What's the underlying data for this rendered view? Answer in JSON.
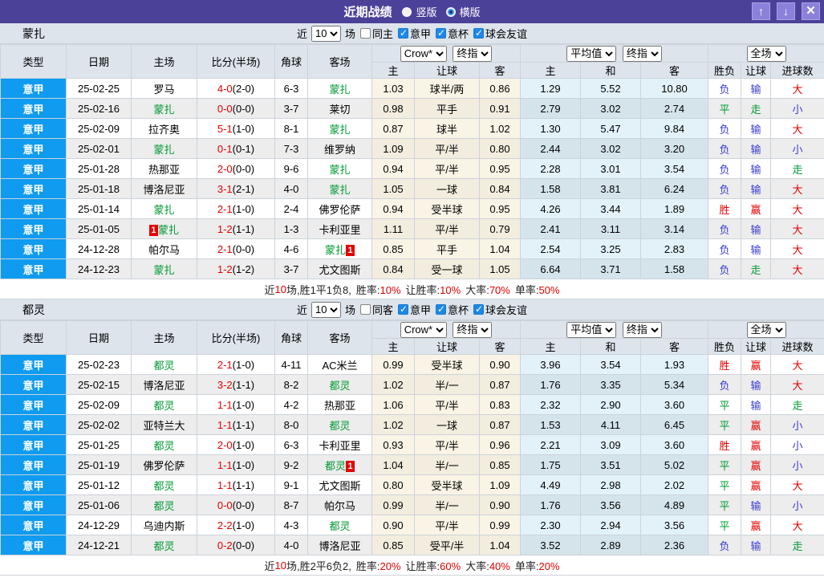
{
  "title_bar": {
    "title": "近期战绩",
    "vertical_label": "竖版",
    "vertical_checked": true,
    "horizontal_label": "横版",
    "horizontal_checked": false
  },
  "icons": {
    "move-up": "↑",
    "move-down": "↓",
    "close": "✕"
  },
  "labels": {
    "recent": "近",
    "games": "场",
    "serie_a": "意甲",
    "cup": "意杯",
    "friendly": "球会友谊"
  },
  "columns": {
    "type": "类型",
    "date": "日期",
    "home": "主场",
    "score": "比分(半场)",
    "corner": "角球",
    "away": "客场",
    "crow_home": "主",
    "crow_handicap": "让球",
    "crow_away": "客",
    "avg_home": "主",
    "avg_draw": "和",
    "avg_away": "客",
    "result": "胜负",
    "handicap_result": "让球",
    "goals": "进球数"
  },
  "colors": {
    "accent_purple": "#4c4198",
    "type_blue": "#0f9bef",
    "win_red": "#e30000",
    "draw_green": "#009933",
    "loss_blue": "#3a3ad0"
  },
  "sections": [
    {
      "team": "蒙扎",
      "controls": {
        "same_label": "同主",
        "same_checked": false,
        "serie_a_checked": true,
        "cup_checked": true,
        "friendly_checked": true
      },
      "selects": {
        "count": "10",
        "book": "Crow*",
        "book_period": "终指",
        "avg": "平均值",
        "avg_period": "终指",
        "scope": "全场"
      },
      "rows": [
        {
          "league": "意甲",
          "date": "25-02-25",
          "home": {
            "name": "罗马",
            "self": false
          },
          "score": "4-0",
          "half": "(2-0)",
          "corner": "6-3",
          "away": {
            "name": "蒙扎",
            "self": true
          },
          "crow": [
            "1.03",
            "球半/两",
            "0.86"
          ],
          "avg": [
            "1.29",
            "5.52",
            "10.80"
          ],
          "outcome": [
            "负",
            "输",
            "大"
          ]
        },
        {
          "league": "意甲",
          "date": "25-02-16",
          "home": {
            "name": "蒙扎",
            "self": true
          },
          "score": "0-0",
          "half": "(0-0)",
          "corner": "3-7",
          "away": {
            "name": "莱切",
            "self": false
          },
          "crow": [
            "0.98",
            "平手",
            "0.91"
          ],
          "avg": [
            "2.79",
            "3.02",
            "2.74"
          ],
          "outcome": [
            "平",
            "走",
            "小"
          ]
        },
        {
          "league": "意甲",
          "date": "25-02-09",
          "home": {
            "name": "拉齐奥",
            "self": false
          },
          "score": "5-1",
          "half": "(1-0)",
          "corner": "8-1",
          "away": {
            "name": "蒙扎",
            "self": true
          },
          "crow": [
            "0.87",
            "球半",
            "1.02"
          ],
          "avg": [
            "1.30",
            "5.47",
            "9.84"
          ],
          "outcome": [
            "负",
            "输",
            "大"
          ]
        },
        {
          "league": "意甲",
          "date": "25-02-01",
          "home": {
            "name": "蒙扎",
            "self": true
          },
          "score": "0-1",
          "half": "(0-1)",
          "corner": "7-3",
          "away": {
            "name": "维罗纳",
            "self": false
          },
          "crow": [
            "1.09",
            "平/半",
            "0.80"
          ],
          "avg": [
            "2.44",
            "3.02",
            "3.20"
          ],
          "outcome": [
            "负",
            "输",
            "小"
          ]
        },
        {
          "league": "意甲",
          "date": "25-01-28",
          "home": {
            "name": "热那亚",
            "self": false
          },
          "score": "2-0",
          "half": "(0-0)",
          "corner": "9-6",
          "away": {
            "name": "蒙扎",
            "self": true
          },
          "crow": [
            "0.94",
            "平/半",
            "0.95"
          ],
          "avg": [
            "2.28",
            "3.01",
            "3.54"
          ],
          "outcome": [
            "负",
            "输",
            "走"
          ]
        },
        {
          "league": "意甲",
          "date": "25-01-18",
          "home": {
            "name": "博洛尼亚",
            "self": false
          },
          "score": "3-1",
          "half": "(2-1)",
          "corner": "4-0",
          "away": {
            "name": "蒙扎",
            "self": true
          },
          "crow": [
            "1.05",
            "一球",
            "0.84"
          ],
          "avg": [
            "1.58",
            "3.81",
            "6.24"
          ],
          "outcome": [
            "负",
            "输",
            "大"
          ]
        },
        {
          "league": "意甲",
          "date": "25-01-14",
          "home": {
            "name": "蒙扎",
            "self": true
          },
          "score": "2-1",
          "half": "(1-0)",
          "corner": "2-4",
          "away": {
            "name": "佛罗伦萨",
            "self": false
          },
          "crow": [
            "0.94",
            "受半球",
            "0.95"
          ],
          "avg": [
            "4.26",
            "3.44",
            "1.89"
          ],
          "outcome": [
            "胜",
            "赢",
            "大"
          ]
        },
        {
          "league": "意甲",
          "date": "25-01-05",
          "home": {
            "name": "蒙扎",
            "self": true,
            "card": "1",
            "card_pos": "before"
          },
          "score": "1-2",
          "half": "(1-1)",
          "corner": "1-3",
          "away": {
            "name": "卡利亚里",
            "self": false
          },
          "crow": [
            "1.11",
            "平/半",
            "0.79"
          ],
          "avg": [
            "2.41",
            "3.11",
            "3.14"
          ],
          "outcome": [
            "负",
            "输",
            "大"
          ]
        },
        {
          "league": "意甲",
          "date": "24-12-28",
          "home": {
            "name": "帕尔马",
            "self": false
          },
          "score": "2-1",
          "half": "(0-0)",
          "corner": "4-6",
          "away": {
            "name": "蒙扎",
            "self": true,
            "card": "1",
            "card_pos": "after"
          },
          "crow": [
            "0.85",
            "平手",
            "1.04"
          ],
          "avg": [
            "2.54",
            "3.25",
            "2.83"
          ],
          "outcome": [
            "负",
            "输",
            "大"
          ]
        },
        {
          "league": "意甲",
          "date": "24-12-23",
          "home": {
            "name": "蒙扎",
            "self": true
          },
          "score": "1-2",
          "half": "(1-2)",
          "corner": "3-7",
          "away": {
            "name": "尤文图斯",
            "self": false
          },
          "crow": [
            "0.84",
            "受一球",
            "1.05"
          ],
          "avg": [
            "6.64",
            "3.71",
            "1.58"
          ],
          "outcome": [
            "负",
            "走",
            "大"
          ]
        }
      ],
      "summary": {
        "lead": "近",
        "count": "10",
        "record": "场,胜1平1负8,",
        "stats": [
          {
            "label": "胜率:",
            "value": "10%"
          },
          {
            "label": "让胜率:",
            "value": "10%"
          },
          {
            "label": "大率:",
            "value": "70%"
          },
          {
            "label": "单率:",
            "value": "50%"
          }
        ]
      }
    },
    {
      "team": "都灵",
      "controls": {
        "same_label": "同客",
        "same_checked": false,
        "serie_a_checked": true,
        "cup_checked": true,
        "friendly_checked": true
      },
      "selects": {
        "count": "10",
        "book": "Crow*",
        "book_period": "终指",
        "avg": "平均值",
        "avg_period": "终指",
        "scope": "全场"
      },
      "rows": [
        {
          "league": "意甲",
          "date": "25-02-23",
          "home": {
            "name": "都灵",
            "self": true
          },
          "score": "2-1",
          "half": "(1-0)",
          "corner": "4-11",
          "away": {
            "name": "AC米兰",
            "self": false
          },
          "crow": [
            "0.99",
            "受半球",
            "0.90"
          ],
          "avg": [
            "3.96",
            "3.54",
            "1.93"
          ],
          "outcome": [
            "胜",
            "赢",
            "大"
          ]
        },
        {
          "league": "意甲",
          "date": "25-02-15",
          "home": {
            "name": "博洛尼亚",
            "self": false
          },
          "score": "3-2",
          "half": "(1-1)",
          "corner": "8-2",
          "away": {
            "name": "都灵",
            "self": true
          },
          "crow": [
            "1.02",
            "半/一",
            "0.87"
          ],
          "avg": [
            "1.76",
            "3.35",
            "5.34"
          ],
          "outcome": [
            "负",
            "输",
            "大"
          ]
        },
        {
          "league": "意甲",
          "date": "25-02-09",
          "home": {
            "name": "都灵",
            "self": true
          },
          "score": "1-1",
          "half": "(1-0)",
          "corner": "4-2",
          "away": {
            "name": "热那亚",
            "self": false
          },
          "crow": [
            "1.06",
            "平/半",
            "0.83"
          ],
          "avg": [
            "2.32",
            "2.90",
            "3.60"
          ],
          "outcome": [
            "平",
            "输",
            "走"
          ]
        },
        {
          "league": "意甲",
          "date": "25-02-02",
          "home": {
            "name": "亚特兰大",
            "self": false
          },
          "score": "1-1",
          "half": "(1-1)",
          "corner": "8-0",
          "away": {
            "name": "都灵",
            "self": true
          },
          "crow": [
            "1.02",
            "一球",
            "0.87"
          ],
          "avg": [
            "1.53",
            "4.11",
            "6.45"
          ],
          "outcome": [
            "平",
            "赢",
            "小"
          ]
        },
        {
          "league": "意甲",
          "date": "25-01-25",
          "home": {
            "name": "都灵",
            "self": true
          },
          "score": "2-0",
          "half": "(1-0)",
          "corner": "6-3",
          "away": {
            "name": "卡利亚里",
            "self": false
          },
          "crow": [
            "0.93",
            "平/半",
            "0.96"
          ],
          "avg": [
            "2.21",
            "3.09",
            "3.60"
          ],
          "outcome": [
            "胜",
            "赢",
            "小"
          ]
        },
        {
          "league": "意甲",
          "date": "25-01-19",
          "home": {
            "name": "佛罗伦萨",
            "self": false
          },
          "score": "1-1",
          "half": "(1-0)",
          "corner": "9-2",
          "away": {
            "name": "都灵",
            "self": true,
            "card": "1",
            "card_pos": "after"
          },
          "crow": [
            "1.04",
            "半/一",
            "0.85"
          ],
          "avg": [
            "1.75",
            "3.51",
            "5.02"
          ],
          "outcome": [
            "平",
            "赢",
            "小"
          ]
        },
        {
          "league": "意甲",
          "date": "25-01-12",
          "home": {
            "name": "都灵",
            "self": true
          },
          "score": "1-1",
          "half": "(1-1)",
          "corner": "9-1",
          "away": {
            "name": "尤文图斯",
            "self": false
          },
          "crow": [
            "0.80",
            "受半球",
            "1.09"
          ],
          "avg": [
            "4.49",
            "2.98",
            "2.02"
          ],
          "outcome": [
            "平",
            "赢",
            "大"
          ]
        },
        {
          "league": "意甲",
          "date": "25-01-06",
          "home": {
            "name": "都灵",
            "self": true
          },
          "score": "0-0",
          "half": "(0-0)",
          "corner": "8-7",
          "away": {
            "name": "帕尔马",
            "self": false
          },
          "crow": [
            "0.99",
            "半/一",
            "0.90"
          ],
          "avg": [
            "1.76",
            "3.56",
            "4.89"
          ],
          "outcome": [
            "平",
            "输",
            "小"
          ]
        },
        {
          "league": "意甲",
          "date": "24-12-29",
          "home": {
            "name": "乌迪内斯",
            "self": false
          },
          "score": "2-2",
          "half": "(1-0)",
          "corner": "4-3",
          "away": {
            "name": "都灵",
            "self": true
          },
          "crow": [
            "0.90",
            "平/半",
            "0.99"
          ],
          "avg": [
            "2.30",
            "2.94",
            "3.56"
          ],
          "outcome": [
            "平",
            "赢",
            "大"
          ]
        },
        {
          "league": "意甲",
          "date": "24-12-21",
          "home": {
            "name": "都灵",
            "self": true
          },
          "score": "0-2",
          "half": "(0-0)",
          "corner": "4-0",
          "away": {
            "name": "博洛尼亚",
            "self": false
          },
          "crow": [
            "0.85",
            "受平/半",
            "1.04"
          ],
          "avg": [
            "3.52",
            "2.89",
            "2.36"
          ],
          "outcome": [
            "负",
            "输",
            "走"
          ]
        }
      ],
      "summary": {
        "lead": "近",
        "count": "10",
        "record": "场,胜2平6负2,",
        "stats": [
          {
            "label": "胜率:",
            "value": "20%"
          },
          {
            "label": "让胜率:",
            "value": "60%"
          },
          {
            "label": "大率:",
            "value": "40%"
          },
          {
            "label": "单率:",
            "value": "20%"
          }
        ]
      }
    }
  ]
}
